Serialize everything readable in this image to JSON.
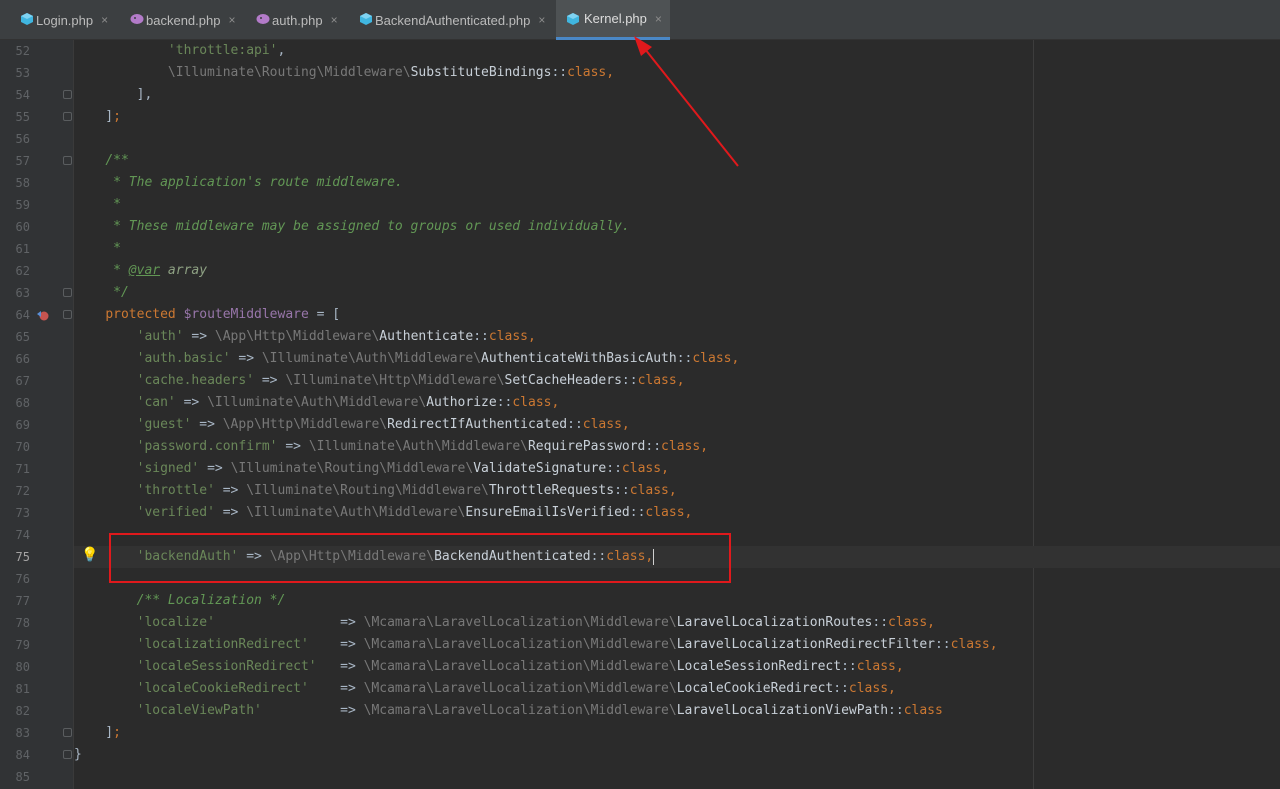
{
  "tabs": [
    {
      "label": "Login.php",
      "icon": "php-class-icon",
      "active": false
    },
    {
      "label": "backend.php",
      "icon": "php-file-icon",
      "active": false
    },
    {
      "label": "auth.php",
      "icon": "php-file-icon",
      "active": false
    },
    {
      "label": "BackendAuthenticated.php",
      "icon": "php-class-icon",
      "active": false
    },
    {
      "label": "Kernel.php",
      "icon": "php-class-icon",
      "active": true
    }
  ],
  "close_glyph": "×",
  "editor": {
    "current_line": 75,
    "lines": [
      {
        "n": "52"
      },
      {
        "n": "53"
      },
      {
        "n": "54"
      },
      {
        "n": "55"
      },
      {
        "n": "56"
      },
      {
        "n": "57"
      },
      {
        "n": "58"
      },
      {
        "n": "59"
      },
      {
        "n": "60"
      },
      {
        "n": "61"
      },
      {
        "n": "62"
      },
      {
        "n": "63"
      },
      {
        "n": "64"
      },
      {
        "n": "65"
      },
      {
        "n": "66"
      },
      {
        "n": "67"
      },
      {
        "n": "68"
      },
      {
        "n": "69"
      },
      {
        "n": "70"
      },
      {
        "n": "71"
      },
      {
        "n": "72"
      },
      {
        "n": "73"
      },
      {
        "n": "74"
      },
      {
        "n": "75"
      },
      {
        "n": "76"
      },
      {
        "n": "77"
      },
      {
        "n": "78"
      },
      {
        "n": "79"
      },
      {
        "n": "80"
      },
      {
        "n": "81"
      },
      {
        "n": "82"
      },
      {
        "n": "83"
      },
      {
        "n": "84"
      },
      {
        "n": "85"
      }
    ],
    "code": {
      "l52_str": "'throttle:api'",
      "l53_ns": "\\Illuminate\\Routing\\Middleware\\",
      "l53_cls": "SubstituteBindings",
      "kw_class": "class",
      "l57": "/**",
      "l58": " * The application's route middleware.",
      "l59": " *",
      "l60": " * These middleware may be assigned to groups or used individually.",
      "l61": " *",
      "l62_pre": " * ",
      "l62_tag": "@var",
      "l62_post": " array",
      "l63": " */",
      "l64_kw": "protected",
      "l64_var": "$routeMiddleware",
      "entries": [
        {
          "key": "'auth'",
          "ns": "\\App\\Http\\Middleware\\",
          "cls": "Authenticate"
        },
        {
          "key": "'auth.basic'",
          "ns": "\\Illuminate\\Auth\\Middleware\\",
          "cls": "AuthenticateWithBasicAuth"
        },
        {
          "key": "'cache.headers'",
          "ns": "\\Illuminate\\Http\\Middleware\\",
          "cls": "SetCacheHeaders"
        },
        {
          "key": "'can'",
          "ns": "\\Illuminate\\Auth\\Middleware\\",
          "cls": "Authorize"
        },
        {
          "key": "'guest'",
          "ns": "\\App\\Http\\Middleware\\",
          "cls": "RedirectIfAuthenticated"
        },
        {
          "key": "'password.confirm'",
          "ns": "\\Illuminate\\Auth\\Middleware\\",
          "cls": "RequirePassword"
        },
        {
          "key": "'signed'",
          "ns": "\\Illuminate\\Routing\\Middleware\\",
          "cls": "ValidateSignature"
        },
        {
          "key": "'throttle'",
          "ns": "\\Illuminate\\Routing\\Middleware\\",
          "cls": "ThrottleRequests"
        },
        {
          "key": "'verified'",
          "ns": "\\Illuminate\\Auth\\Middleware\\",
          "cls": "EnsureEmailIsVerified"
        }
      ],
      "backend": {
        "key": "'backendAuth'",
        "ns": "\\App\\Http\\Middleware\\",
        "cls": "BackendAuthenticated"
      },
      "l77": "/** Localization */",
      "loc_entries": [
        {
          "key": "'localize'",
          "pad": "                ",
          "ns": "\\Mcamara\\LaravelLocalization\\Middleware\\",
          "cls": "LaravelLocalizationRoutes",
          "trail": ","
        },
        {
          "key": "'localizationRedirect'",
          "pad": "    ",
          "ns": "\\Mcamara\\LaravelLocalization\\Middleware\\",
          "cls": "LaravelLocalizationRedirectFilter",
          "trail": ","
        },
        {
          "key": "'localeSessionRedirect'",
          "pad": "   ",
          "ns": "\\Mcamara\\LaravelLocalization\\Middleware\\",
          "cls": "LocaleSessionRedirect",
          "trail": ","
        },
        {
          "key": "'localeCookieRedirect'",
          "pad": "    ",
          "ns": "\\Mcamara\\LaravelLocalization\\Middleware\\",
          "cls": "LocaleCookieRedirect",
          "trail": ","
        },
        {
          "key": "'localeViewPath'",
          "pad": "          ",
          "ns": "\\Mcamara\\LaravelLocalization\\Middleware\\",
          "cls": "LaravelLocalizationViewPath",
          "trail": ""
        }
      ]
    }
  },
  "annotation_color": "#e0191c"
}
